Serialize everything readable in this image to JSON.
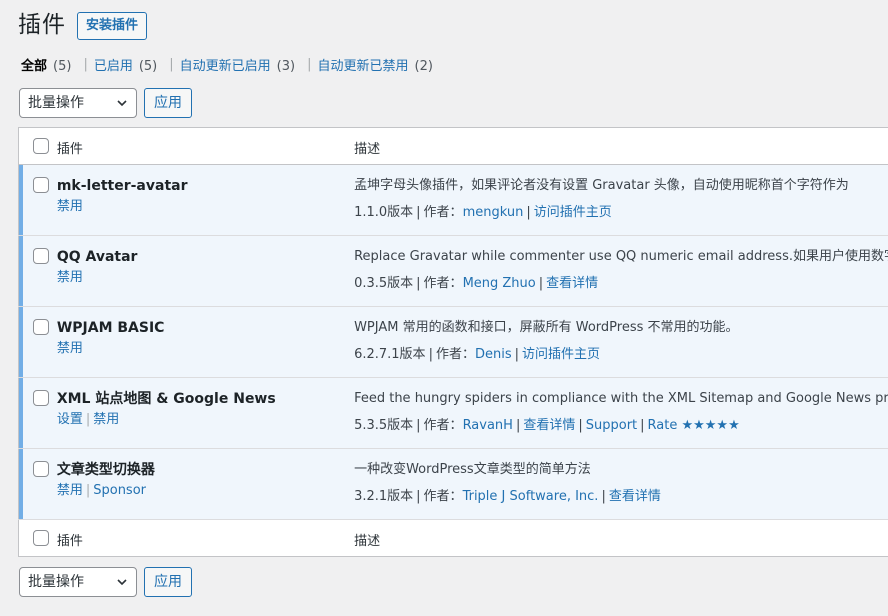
{
  "page": {
    "title": "插件",
    "add_new": "安装插件"
  },
  "filters": [
    {
      "label": "全部",
      "count": "(5)",
      "current": true
    },
    {
      "label": "已启用",
      "count": "(5)"
    },
    {
      "label": "自动更新已启用",
      "count": "(3)"
    },
    {
      "label": "自动更新已禁用",
      "count": "(2)"
    }
  ],
  "bulk": {
    "select_label": "批量操作",
    "apply_label": "应用"
  },
  "columns": {
    "plugin": "插件",
    "description": "描述"
  },
  "plugins": [
    {
      "name": "mk-letter-avatar",
      "actions": [
        "禁用"
      ],
      "description": "孟坤字母头像插件，如果评论者没有设置 Gravatar 头像，自动使用昵称首个字符作为",
      "version": "1.1.0版本",
      "author_label": "作者：",
      "author": "mengkun",
      "links": [
        "访问插件主页"
      ]
    },
    {
      "name": "QQ Avatar",
      "actions": [
        "禁用"
      ],
      "description": "Replace Gravatar while commenter use QQ numeric email address.如果用户使用数字",
      "version": "0.3.5版本",
      "author_label": "作者：",
      "author": "Meng Zhuo",
      "links": [
        "查看详情"
      ]
    },
    {
      "name": "WPJAM BASIC",
      "actions": [
        "禁用"
      ],
      "description": "WPJAM 常用的函数和接口，屏蔽所有 WordPress 不常用的功能。",
      "version": "6.2.7.1版本",
      "author_label": "作者：",
      "author": "Denis",
      "links": [
        "访问插件主页"
      ]
    },
    {
      "name": "XML 站点地图 & Google News",
      "actions": [
        "设置",
        "禁用"
      ],
      "description": "Feed the hungry spiders in compliance with the XML Sitemap and Google News pro",
      "version": "5.3.5版本",
      "author_label": "作者：",
      "author": "RavanH",
      "links": [
        "查看详情",
        "Support",
        "Rate ★★★★★"
      ]
    },
    {
      "name": "文章类型切换器",
      "actions": [
        "禁用",
        "Sponsor"
      ],
      "description": "一种改变WordPress文章类型的简单方法",
      "version": "3.2.1版本",
      "author_label": "作者：",
      "author": "Triple J Software, Inc.",
      "links": [
        "查看详情"
      ]
    }
  ],
  "colors": {
    "link": "#2271b1",
    "active_border": "#72aee6",
    "active_bg": "#f0f6fc"
  }
}
